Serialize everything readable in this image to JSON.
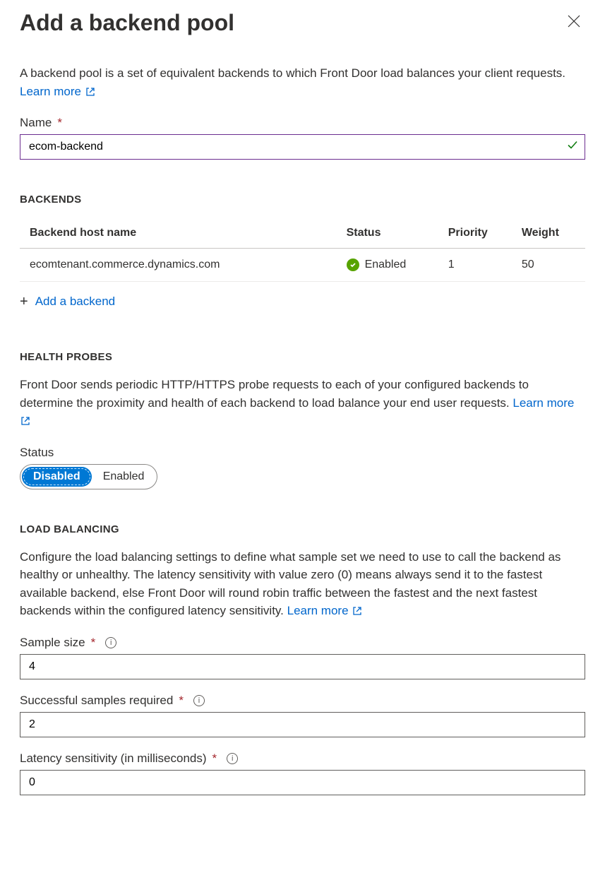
{
  "title": "Add a backend pool",
  "intro": {
    "text": "A backend pool is a set of equivalent backends to which Front Door load balances your client requests. ",
    "learn_more": "Learn more"
  },
  "name_field": {
    "label": "Name",
    "value": "ecom-backend"
  },
  "backends": {
    "heading": "BACKENDS",
    "columns": {
      "host": "Backend host name",
      "status": "Status",
      "priority": "Priority",
      "weight": "Weight"
    },
    "rows": [
      {
        "host": "ecomtenant.commerce.dynamics.com",
        "status": "Enabled",
        "priority": "1",
        "weight": "50"
      }
    ],
    "add_label": "Add a backend"
  },
  "health_probes": {
    "heading": "HEALTH PROBES",
    "desc": "Front Door sends periodic HTTP/HTTPS probe requests to each of your configured backends to determine the proximity and health of each backend to load balance your end user requests. ",
    "learn_more": "Learn more",
    "status_label": "Status",
    "options": {
      "disabled": "Disabled",
      "enabled": "Enabled"
    },
    "selected": "disabled"
  },
  "load_balancing": {
    "heading": "LOAD BALANCING",
    "desc": "Configure the load balancing settings to define what sample set we need to use to call the backend as healthy or unhealthy. The latency sensitivity with value zero (0) means always send it to the fastest available backend, else Front Door will round robin traffic between the fastest and the next fastest backends within the configured latency sensitivity. ",
    "learn_more": "Learn more",
    "sample_size": {
      "label": "Sample size",
      "value": "4"
    },
    "successful_samples": {
      "label": "Successful samples required",
      "value": "2"
    },
    "latency": {
      "label": "Latency sensitivity (in milliseconds)",
      "value": "0"
    }
  }
}
